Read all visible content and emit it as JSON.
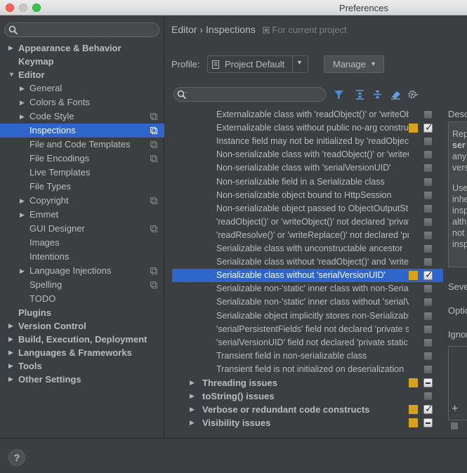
{
  "window": {
    "title": "Preferences"
  },
  "sidebar": {
    "search_placeholder": "",
    "items": [
      {
        "label": "Appearance & Behavior",
        "level": 0,
        "bold": true,
        "arrow": "right"
      },
      {
        "label": "Keymap",
        "level": 0,
        "bold": true,
        "arrow": ""
      },
      {
        "label": "Editor",
        "level": 0,
        "bold": true,
        "arrow": "down"
      },
      {
        "label": "General",
        "level": 1,
        "bold": false,
        "arrow": "right"
      },
      {
        "label": "Colors & Fonts",
        "level": 1,
        "bold": false,
        "arrow": "right"
      },
      {
        "label": "Code Style",
        "level": 1,
        "bold": false,
        "arrow": "right",
        "copy": true
      },
      {
        "label": "Inspections",
        "level": 1,
        "bold": false,
        "arrow": "",
        "copy": true,
        "selected": true
      },
      {
        "label": "File and Code Templates",
        "level": 1,
        "bold": false,
        "arrow": "",
        "copy": true
      },
      {
        "label": "File Encodings",
        "level": 1,
        "bold": false,
        "arrow": "",
        "copy": true
      },
      {
        "label": "Live Templates",
        "level": 1,
        "bold": false,
        "arrow": ""
      },
      {
        "label": "File Types",
        "level": 1,
        "bold": false,
        "arrow": ""
      },
      {
        "label": "Copyright",
        "level": 1,
        "bold": false,
        "arrow": "right",
        "copy": true
      },
      {
        "label": "Emmet",
        "level": 1,
        "bold": false,
        "arrow": "right"
      },
      {
        "label": "GUI Designer",
        "level": 1,
        "bold": false,
        "arrow": "",
        "copy": true
      },
      {
        "label": "Images",
        "level": 1,
        "bold": false,
        "arrow": ""
      },
      {
        "label": "Intentions",
        "level": 1,
        "bold": false,
        "arrow": ""
      },
      {
        "label": "Language Injections",
        "level": 1,
        "bold": false,
        "arrow": "right",
        "copy": true
      },
      {
        "label": "Spelling",
        "level": 1,
        "bold": false,
        "arrow": "",
        "copy": true
      },
      {
        "label": "TODO",
        "level": 1,
        "bold": false,
        "arrow": ""
      },
      {
        "label": "Plugins",
        "level": 0,
        "bold": true,
        "arrow": ""
      },
      {
        "label": "Version Control",
        "level": 0,
        "bold": true,
        "arrow": "right"
      },
      {
        "label": "Build, Execution, Deployment",
        "level": 0,
        "bold": true,
        "arrow": "right"
      },
      {
        "label": "Languages & Frameworks",
        "level": 0,
        "bold": true,
        "arrow": "right"
      },
      {
        "label": "Tools",
        "level": 0,
        "bold": true,
        "arrow": "right"
      },
      {
        "label": "Other Settings",
        "level": 0,
        "bold": true,
        "arrow": "right"
      }
    ]
  },
  "header": {
    "breadcrumb_editor": "Editor",
    "breadcrumb_sep": "›",
    "breadcrumb_current": "Inspections",
    "scope": "For current project"
  },
  "profile": {
    "label": "Profile:",
    "value": "Project Default",
    "manage_label": "Manage"
  },
  "inspections": [
    {
      "text": "Externalizable class with 'readObject()' or 'writeObject()'",
      "severity": false,
      "check": "off"
    },
    {
      "text": "Externalizable class without public no-arg constructor",
      "severity": true,
      "check": "on"
    },
    {
      "text": "Instance field may not be initialized by 'readObject()'",
      "severity": false,
      "check": "off"
    },
    {
      "text": "Non-serializable class with 'readObject()' or 'writeObject()'",
      "severity": false,
      "check": "off"
    },
    {
      "text": "Non-serializable class with 'serialVersionUID'",
      "severity": false,
      "check": "off"
    },
    {
      "text": "Non-serializable field in a Serializable class",
      "severity": false,
      "check": "off"
    },
    {
      "text": "Non-serializable object bound to HttpSession",
      "severity": false,
      "check": "off"
    },
    {
      "text": "Non-serializable object passed to ObjectOutputStream",
      "severity": false,
      "check": "off"
    },
    {
      "text": "'readObject()' or 'writeObject()' not declared 'private'",
      "severity": false,
      "check": "off"
    },
    {
      "text": "'readResolve()' or 'writeReplace()' not declared 'protected'",
      "severity": false,
      "check": "off"
    },
    {
      "text": "Serializable class with unconstructable ancestor",
      "severity": false,
      "check": "off"
    },
    {
      "text": "Serializable class without 'readObject()' and 'writeObject()'",
      "severity": false,
      "check": "off"
    },
    {
      "text": "Serializable class without 'serialVersionUID'",
      "severity": true,
      "check": "on",
      "selected": true
    },
    {
      "text": "Serializable non-'static' inner class with non-Serializable outer class",
      "severity": false,
      "check": "off"
    },
    {
      "text": "Serializable non-'static' inner class without 'serialVersionUID'",
      "severity": false,
      "check": "off"
    },
    {
      "text": "Serializable object implicitly stores non-Serializable object",
      "severity": false,
      "check": "off"
    },
    {
      "text": "'serialPersistentFields' field not declared 'private static final'",
      "severity": false,
      "check": "off"
    },
    {
      "text": "'serialVersionUID' field not declared 'private static final long'",
      "severity": false,
      "check": "off"
    },
    {
      "text": "Transient field in non-serializable class",
      "severity": false,
      "check": "off"
    },
    {
      "text": "Transient field is not initialized on deserialization",
      "severity": false,
      "check": "off"
    }
  ],
  "groups": [
    {
      "text": "Threading issues",
      "severity": true,
      "check": "partial"
    },
    {
      "text": "toString() issues",
      "severity": false,
      "check": "off"
    },
    {
      "text": "Verbose or redundant code constructs",
      "severity": true,
      "check": "on"
    },
    {
      "text": "Visibility issues",
      "severity": true,
      "check": "partial"
    }
  ],
  "description": {
    "title": "Desc",
    "lines_a": [
      "Rep",
      "ser",
      "any",
      "vers"
    ],
    "lines_b": [
      "Use",
      "inhe",
      "insp",
      "alth",
      "not",
      "insp"
    ],
    "severity_label": "Seve",
    "options_label": "Optio",
    "ignore_label": "Ignor",
    "add_label": "+"
  },
  "colors": {
    "accent": "#2f65ca",
    "severity_warning": "#d4a21b",
    "background": "#3c3f41"
  },
  "help_label": "?"
}
